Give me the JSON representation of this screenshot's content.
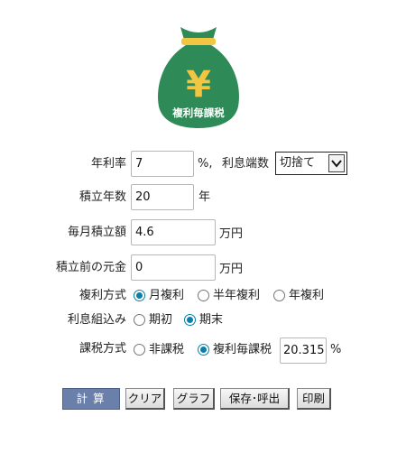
{
  "logo": {
    "symbol": "¥",
    "text": "複利毎課税",
    "bag_color": "#2e8b57",
    "tie_color": "#f2c542"
  },
  "form": {
    "rate": {
      "label": "年利率",
      "value": "7",
      "unit": "%,"
    },
    "rounding": {
      "label": "利息端数",
      "selected": "切捨て"
    },
    "years": {
      "label": "積立年数",
      "value": "20",
      "unit": "年"
    },
    "monthly": {
      "label": "毎月積立額",
      "value": "4.6",
      "unit": "万円"
    },
    "principal": {
      "label": "積立前の元金",
      "value": "0",
      "unit": "万円"
    },
    "compound": {
      "label": "複利方式",
      "options": [
        "月複利",
        "半年複利",
        "年複利"
      ],
      "selected": "月複利"
    },
    "interest_timing": {
      "label": "利息組込み",
      "options": [
        "期初",
        "期末"
      ],
      "selected": "期末"
    },
    "tax": {
      "label": "課税方式",
      "options": [
        "非課税",
        "複利毎課税"
      ],
      "selected": "複利毎課税",
      "rate_value": "20.315",
      "rate_unit": "%"
    }
  },
  "buttons": {
    "calculate": "計算",
    "clear": "クリア",
    "graph": "グラフ",
    "save_load": "保存･呼出",
    "print": "印刷"
  },
  "colors": {
    "primary_button": "#6a7fa9",
    "radio_accent": "#0b7fa5"
  }
}
